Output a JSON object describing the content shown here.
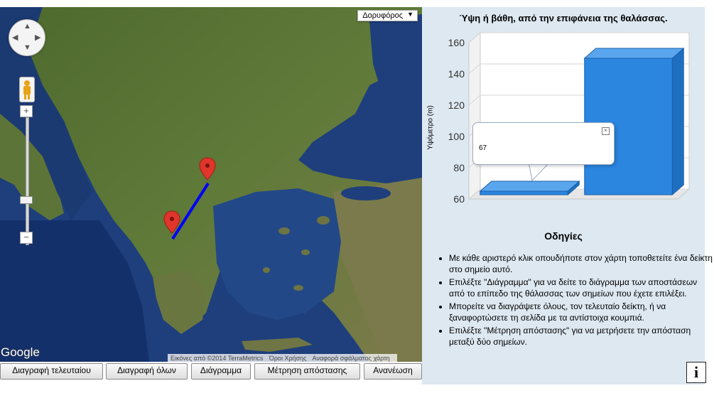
{
  "map": {
    "map_type_label": "Δορυφόρος",
    "google_logo": "Google",
    "attribution": {
      "imagery": "Εικόνες από ©2014 TerraMetrics",
      "terms": "Όροι Χρήσης",
      "report": "Αναφορά σφάλματος χάρτη"
    },
    "markers": [
      "marker-1",
      "marker-2"
    ],
    "path_color": "#0000ff"
  },
  "toolbar": {
    "delete_last": "Διαγραφή τελευταίου",
    "delete_all": "Διαγραφή όλων",
    "diagram": "Διάγραμμα",
    "measure_distance": "Μέτρηση απόστασης",
    "refresh": "Ανανέωση"
  },
  "chart_data": {
    "type": "bar",
    "title": "Ύψη ή βάθη, από την επιφάνεια της θαλάσσας.",
    "ylabel": "Υψόμετρο (m)",
    "xlabel": "",
    "ylim": [
      60,
      160
    ],
    "yticks": [
      60,
      80,
      100,
      120,
      140,
      160
    ],
    "values": [
      65,
      150
    ],
    "bar_color": "#2b86e0",
    "tooltip_value": "67",
    "grid": true
  },
  "instructions": {
    "title": "Οδηγίες",
    "items": [
      "Με κάθε αριστερό κλικ οπουδήποτε στον χάρτη τοποθετείτε ένα δείκτη στο σημείο αυτό.",
      "Επιλέξτε \"Διάγραμμα\" για να δείτε το διάγραμμα των αποστάσεων από το επίπεδο της θάλασσας των σημείων που έχετε επιλέξει.",
      "Μπορείτε να διαγράψετε όλους, τον τελευταίο δείκτη, ή να ξαναφορτώσετε τη σελίδα με τα αντίστοιχα κουμπιά.",
      "Επιλέξτε \"Μέτρηση απόστασης\" για να μετρήσετε την απόσταση μεταξύ δύο σημείων."
    ]
  },
  "info_button": "i"
}
